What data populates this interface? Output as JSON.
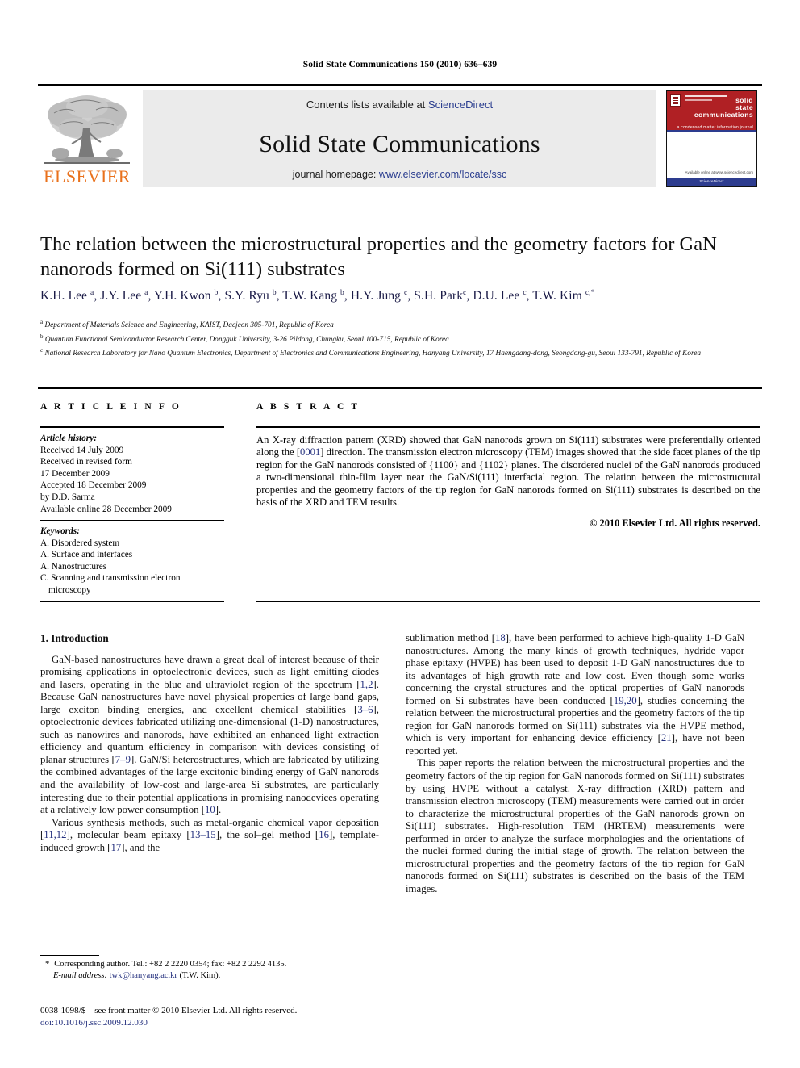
{
  "running_head": "Solid State Communications 150 (2010) 636–639",
  "header": {
    "contents_prefix": "Contents lists available at ",
    "sciencedirect": "ScienceDirect",
    "journal_name": "Solid State Communications",
    "homepage_prefix": "journal homepage: ",
    "homepage_url": "www.elsevier.com/locate/ssc",
    "publisher_wordmark": "ELSEVIER",
    "publisher_logo_icon": "elsevier-tree-icon",
    "accent_orange": "#E9711C",
    "link_blue": "#2a3d8f",
    "cover": {
      "line1": "solid",
      "line2": "state",
      "line3": "communications",
      "tagline": "a condensed matter information journal",
      "footer_text": "Available online at www.sciencedirect.com",
      "bottom_note": "ScienceDirect",
      "red": "#B02024",
      "blue": "#2d3c8f"
    }
  },
  "article": {
    "title": "The relation between the microstructural properties and the geometry factors for GaN nanorods formed on Si(111) substrates",
    "authors_html": "K.H. Lee <sup>a</sup>, J.Y. Lee <sup>a</sup>, Y.H. Kwon <sup>b</sup>, S.Y. Ryu <sup>b</sup>, T.W. Kang <sup>b</sup>, H.Y. Jung <sup>c</sup>, S.H. Park<sup>c</sup>, D.U. Lee <sup>c</sup>, T.W. Kim <sup>c,*</sup>",
    "affiliations": [
      "Department of Materials Science and Engineering, KAIST, Daejeon 305-701, Republic of Korea",
      "Quantum Functional Semiconductor Research Center, Dongguk University, 3-26 Pildong, Chungku, Seoul 100-715, Republic of Korea",
      "National Research Laboratory for Nano Quantum Electronics, Department of Electronics and Communications Engineering, Hanyang University, 17 Haengdang-dong, Seongdong-gu, Seoul 133-791, Republic of Korea"
    ],
    "affiliation_marks": [
      "a",
      "b",
      "c"
    ]
  },
  "info": {
    "heading": "A R T I C L E    I N F O",
    "history_label": "Article history:",
    "history": [
      "Received 14 July 2009",
      "Received in revised form",
      "17 December 2009",
      "Accepted 18 December 2009",
      "by D.D. Sarma",
      "Available online 28 December 2009"
    ],
    "keywords_label": "Keywords:",
    "keywords": [
      "A. Disordered system",
      "A. Surface and interfaces",
      "A. Nanostructures",
      "C. Scanning and transmission electron microscopy"
    ]
  },
  "abstract": {
    "heading": "A B S T R A C T",
    "text_part1": "An X-ray diffraction pattern (XRD) showed that GaN nanorods grown on Si(111) substrates were preferentially oriented along the [0001] direction. The transmission electron microscopy (TEM) images showed that the side facet planes of the tip region for the GaN nanorods consisted of {1100} and {",
    "plane_overline": "1",
    "text_part2": "102} planes. The disordered nuclei of the GaN nanorods produced a two-dimensional thin-film layer near the GaN/Si(111) interfacial region. The relation between the microstructural properties and the geometry factors of the tip region for GaN nanorods formed on Si(111) substrates is described on the basis of the XRD and TEM results.",
    "copyright": "© 2010 Elsevier Ltd. All rights reserved."
  },
  "body": {
    "section_heading": "1. Introduction",
    "left_paragraphs": [
      "GaN-based nanostructures have drawn a great deal of interest because of their promising applications in optoelectronic devices, such as light emitting diodes and lasers, operating in the blue and ultraviolet region of the spectrum [1,2]. Because GaN nanostructures have novel physical properties of large band gaps, large exciton binding energies, and excellent chemical stabilities [3–6], optoelectronic devices fabricated utilizing one-dimensional (1-D) nanostructures, such as nanowires and nanorods, have exhibited an enhanced light extraction efficiency and quantum efficiency in comparison with devices consisting of planar structures [7–9]. GaN/Si heterostructures, which are fabricated by utilizing the combined advantages of the large excitonic binding energy of GaN nanorods and the availability of low-cost and large-area Si substrates, are particularly interesting due to their potential applications in promising nanodevices operating at a relatively low power consumption [10].",
      "Various synthesis methods, such as metal-organic chemical vapor deposition [11,12], molecular beam epitaxy [13–15], the sol–gel method [16], template-induced growth [17], and the"
    ],
    "right_paragraphs": [
      "sublimation method [18], have been performed to achieve high-quality 1-D GaN nanostructures. Among the many kinds of growth techniques, hydride vapor phase epitaxy (HVPE) has been used to deposit 1-D GaN nanostructures due to its advantages of high growth rate and low cost. Even though some works concerning the crystal structures and the optical properties of GaN nanorods formed on Si substrates have been conducted [19,20], studies concerning the relation between the microstructural properties and the geometry factors of the tip region for GaN nanorods formed on Si(111) substrates via the HVPE method, which is very important for enhancing device efficiency [21], have not been reported yet.",
      "This paper reports the relation between the microstructural properties and the geometry factors of the tip region for GaN nanorods formed on Si(111) substrates by using HVPE without a catalyst. X-ray diffraction (XRD) pattern and transmission electron microscopy (TEM) measurements were carried out in order to characterize the microstructural properties of the GaN nanorods grown on Si(111) substrates. High-resolution TEM (HRTEM) measurements were performed in order to analyze the surface morphologies and the orientations of the nuclei formed during the initial stage of growth. The relation between the microstructural properties and the geometry factors of the tip region for GaN nanorods formed on Si(111) substrates is described on the basis of the TEM images."
    ]
  },
  "footer": {
    "corresponding_marker": "*",
    "corresponding_text": "Corresponding author. Tel.: +82 2 2220 0354; fax: +82 2 2292 4135.",
    "email_label": "E-mail address:",
    "email": "twk@hanyang.ac.kr",
    "email_owner": "(T.W. Kim).",
    "issn_line": "0038-1098/$ – see front matter © 2010 Elsevier Ltd. All rights reserved.",
    "doi": "doi:10.1016/j.ssc.2009.12.030"
  }
}
